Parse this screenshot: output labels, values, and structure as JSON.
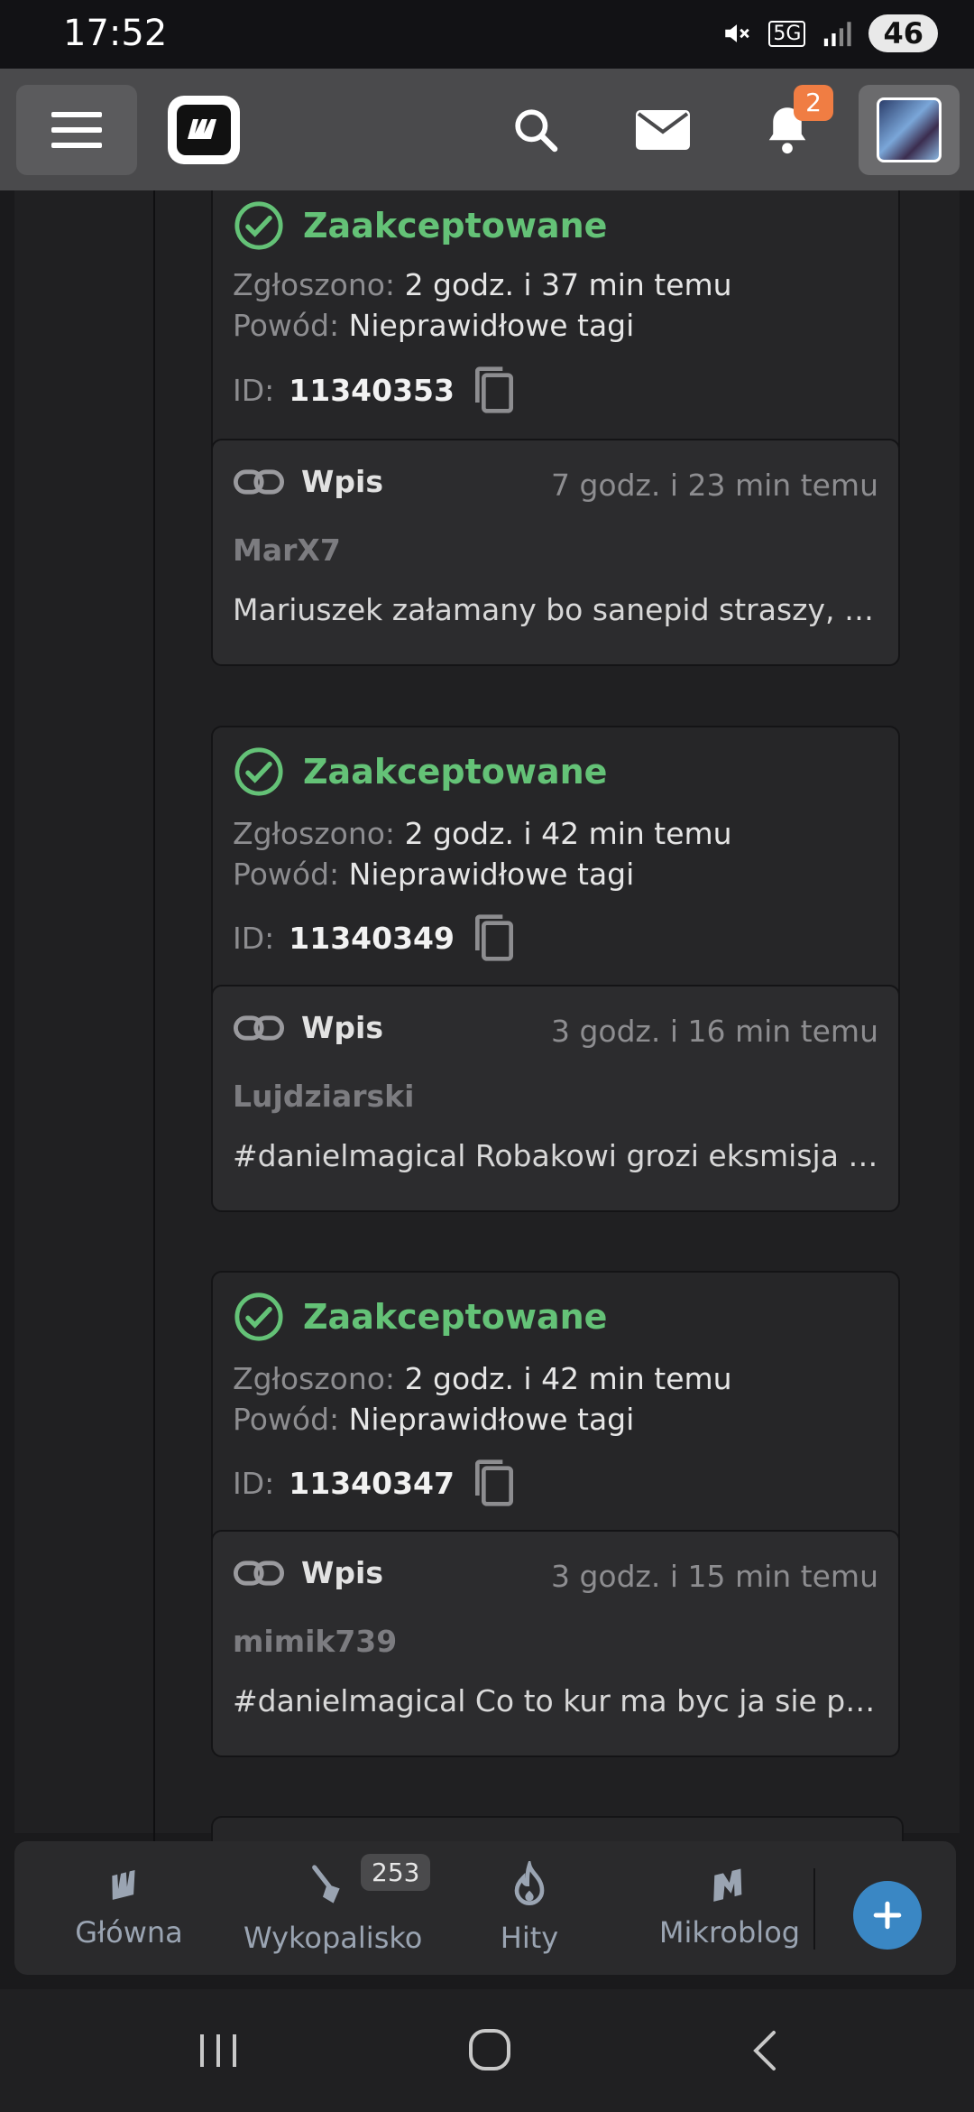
{
  "status_bar": {
    "time": "17:52",
    "battery": "46",
    "network": "5G"
  },
  "top_bar": {
    "notifications_count": "2"
  },
  "reports": [
    {
      "status": "Zaakceptowane",
      "reported_label": "Zgłoszono:",
      "reported_value": "2 godz. i 37 min temu",
      "reason_label": "Powód:",
      "reason_value": "Nieprawidłowe tagi",
      "id_label": "ID:",
      "id_value": "11340353",
      "entry": {
        "type": "Wpis",
        "time": "7 godz. i 23 min temu",
        "user": "MarX7",
        "text": "Mariuszek załamany bo sanepid straszy, że j..."
      }
    },
    {
      "status": "Zaakceptowane",
      "reported_label": "Zgłoszono:",
      "reported_value": "2 godz. i 42 min temu",
      "reason_label": "Powód:",
      "reason_value": "Nieprawidłowe tagi",
      "id_label": "ID:",
      "id_value": "11340349",
      "entry": {
        "type": "Wpis",
        "time": "3 godz. i 16 min temu",
        "user": "Lujdziarski",
        "text": "#danielmagical Robakowi grozi eksmisja tak..."
      }
    },
    {
      "status": "Zaakceptowane",
      "reported_label": "Zgłoszono:",
      "reported_value": "2 godz. i 42 min temu",
      "reason_label": "Powód:",
      "reason_value": "Nieprawidłowe tagi",
      "id_label": "ID:",
      "id_value": "11340347",
      "entry": {
        "type": "Wpis",
        "time": "3 godz. i 15 min temu",
        "user": "mimik739",
        "text": "#danielmagical Co to kur ma byc ja sie pyta..."
      }
    }
  ],
  "bottom_nav": {
    "items": [
      {
        "label": "Główna",
        "icon": "home-logo-icon"
      },
      {
        "label": "Wykopalisko",
        "icon": "shovel-icon",
        "badge": "253"
      },
      {
        "label": "Hity",
        "icon": "flame-icon"
      },
      {
        "label": "Mikroblog",
        "icon": "mikroblog-icon"
      }
    ]
  },
  "colors": {
    "accepted": "#64c277",
    "badge": "#f07d43",
    "fab": "#3a87c4",
    "nav_text": "#9aa4b2"
  }
}
